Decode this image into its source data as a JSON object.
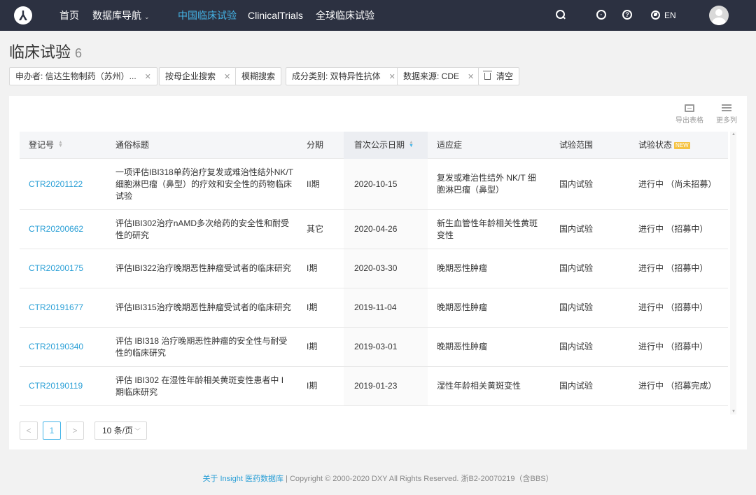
{
  "nav": {
    "items": [
      {
        "label": "首页"
      },
      {
        "label": "数据库导航"
      },
      {
        "label": "中国临床试验"
      },
      {
        "label": "ClinicalTrials"
      },
      {
        "label": "全球临床试验"
      }
    ],
    "lang": "EN",
    "active_color": "#45b5e8"
  },
  "page": {
    "title": "临床试验",
    "count": "6"
  },
  "filters": [
    {
      "label": "申办者: 信达生物制药（苏州）..."
    },
    {
      "label": "按母企业搜索"
    },
    {
      "label": "模糊搜索"
    },
    {
      "label": "成分类别: 双特异性抗体"
    },
    {
      "label": "数据来源: CDE"
    }
  ],
  "clear_label": "清空",
  "tools": {
    "export": "导出表格",
    "more_cols": "更多列"
  },
  "table": {
    "headers": [
      "登记号",
      "通俗标题",
      "分期",
      "首次公示日期",
      "适应症",
      "试验范围",
      "试验状态"
    ],
    "new_badge": "NEW",
    "rows": [
      {
        "id": "CTR20201122",
        "title": "一项评估IBI318单药治疗复发或难治性结外NK/T细胞淋巴瘤（鼻型）的疗效和安全性的药物临床试验",
        "phase": "II期",
        "date": "2020-10-15",
        "indication": "复发或难治性结外 NK/T 细胞淋巴瘤（鼻型）",
        "scope": "国内试验",
        "status": "进行中 （尚未招募）"
      },
      {
        "id": "CTR20200662",
        "title": "评估IBI302治疗nAMD多次给药的安全性和耐受性的研究",
        "phase": "其它",
        "date": "2020-04-26",
        "indication": "新生血管性年龄相关性黄斑变性",
        "scope": "国内试验",
        "status": "进行中 （招募中）"
      },
      {
        "id": "CTR20200175",
        "title": "评估IBI322治疗晚期恶性肿瘤受试者的临床研究",
        "phase": "I期",
        "date": "2020-03-30",
        "indication": "晚期恶性肿瘤",
        "scope": "国内试验",
        "status": "进行中 （招募中）"
      },
      {
        "id": "CTR20191677",
        "title": "评估IBI315治疗晚期恶性肿瘤受试者的临床研究",
        "phase": "I期",
        "date": "2019-11-04",
        "indication": "晚期恶性肿瘤",
        "scope": "国内试验",
        "status": "进行中 （招募中）"
      },
      {
        "id": "CTR20190340",
        "title": "评估 IBI318 治疗晚期恶性肿瘤的安全性与耐受性的临床研究",
        "phase": "I期",
        "date": "2019-03-01",
        "indication": "晚期恶性肿瘤",
        "scope": "国内试验",
        "status": "进行中 （招募中）"
      },
      {
        "id": "CTR20190119",
        "title": "评估 IBI302 在湿性年龄相关黄斑变性患者中 I 期临床研究",
        "phase": "I期",
        "date": "2019-01-23",
        "indication": "湿性年龄相关黄斑变性",
        "scope": "国内试验",
        "status": "进行中 （招募完成）"
      }
    ]
  },
  "pagination": {
    "prev": "<",
    "current": "1",
    "next": ">",
    "page_size": "10 条/页"
  },
  "footer": {
    "link": "关于 Insight 医药数据库",
    "text": " | Copyright © 2000-2020 DXY All Rights Reserved. 浙B2-20070219（含BBS）"
  }
}
